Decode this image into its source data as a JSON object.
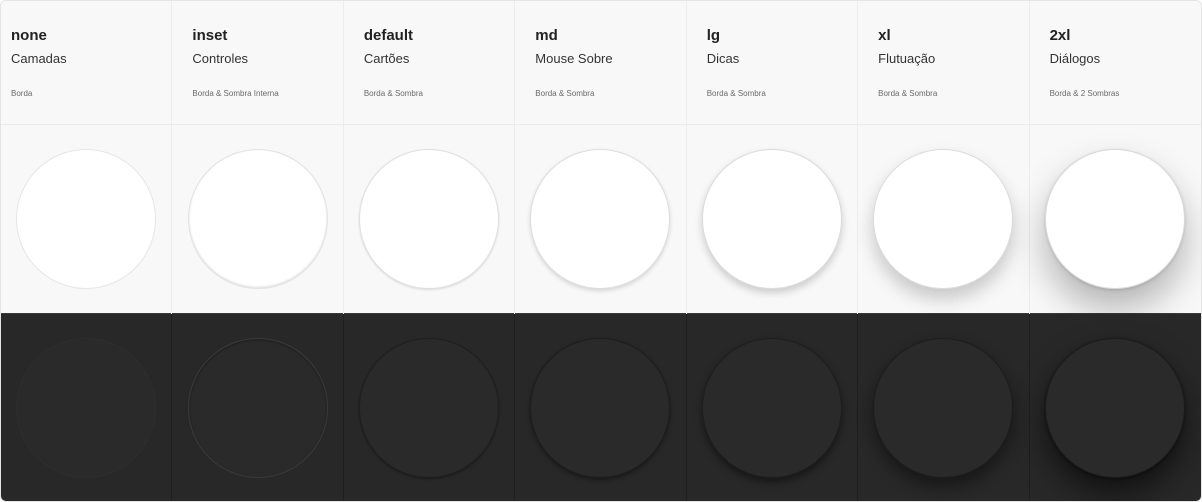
{
  "columns": [
    {
      "token": "none",
      "usage": "Camadas",
      "desc": "Borda"
    },
    {
      "token": "inset",
      "usage": "Controles",
      "desc": "Borda & Sombra Interna"
    },
    {
      "token": "default",
      "usage": "Cartões",
      "desc": "Borda & Sombra"
    },
    {
      "token": "md",
      "usage": "Mouse Sobre",
      "desc": "Borda & Sombra"
    },
    {
      "token": "lg",
      "usage": "Dicas",
      "desc": "Borda & Sombra"
    },
    {
      "token": "xl",
      "usage": "Flutuação",
      "desc": "Borda & Sombra"
    },
    {
      "token": "2xl",
      "usage": "Diálogos",
      "desc": "Borda & 2 Sombras"
    }
  ],
  "colors": {
    "light_surface": "#f8f8f8",
    "dark_surface": "#282828",
    "light_circle": "#ffffff",
    "dark_circle": "#2a2a2a"
  }
}
